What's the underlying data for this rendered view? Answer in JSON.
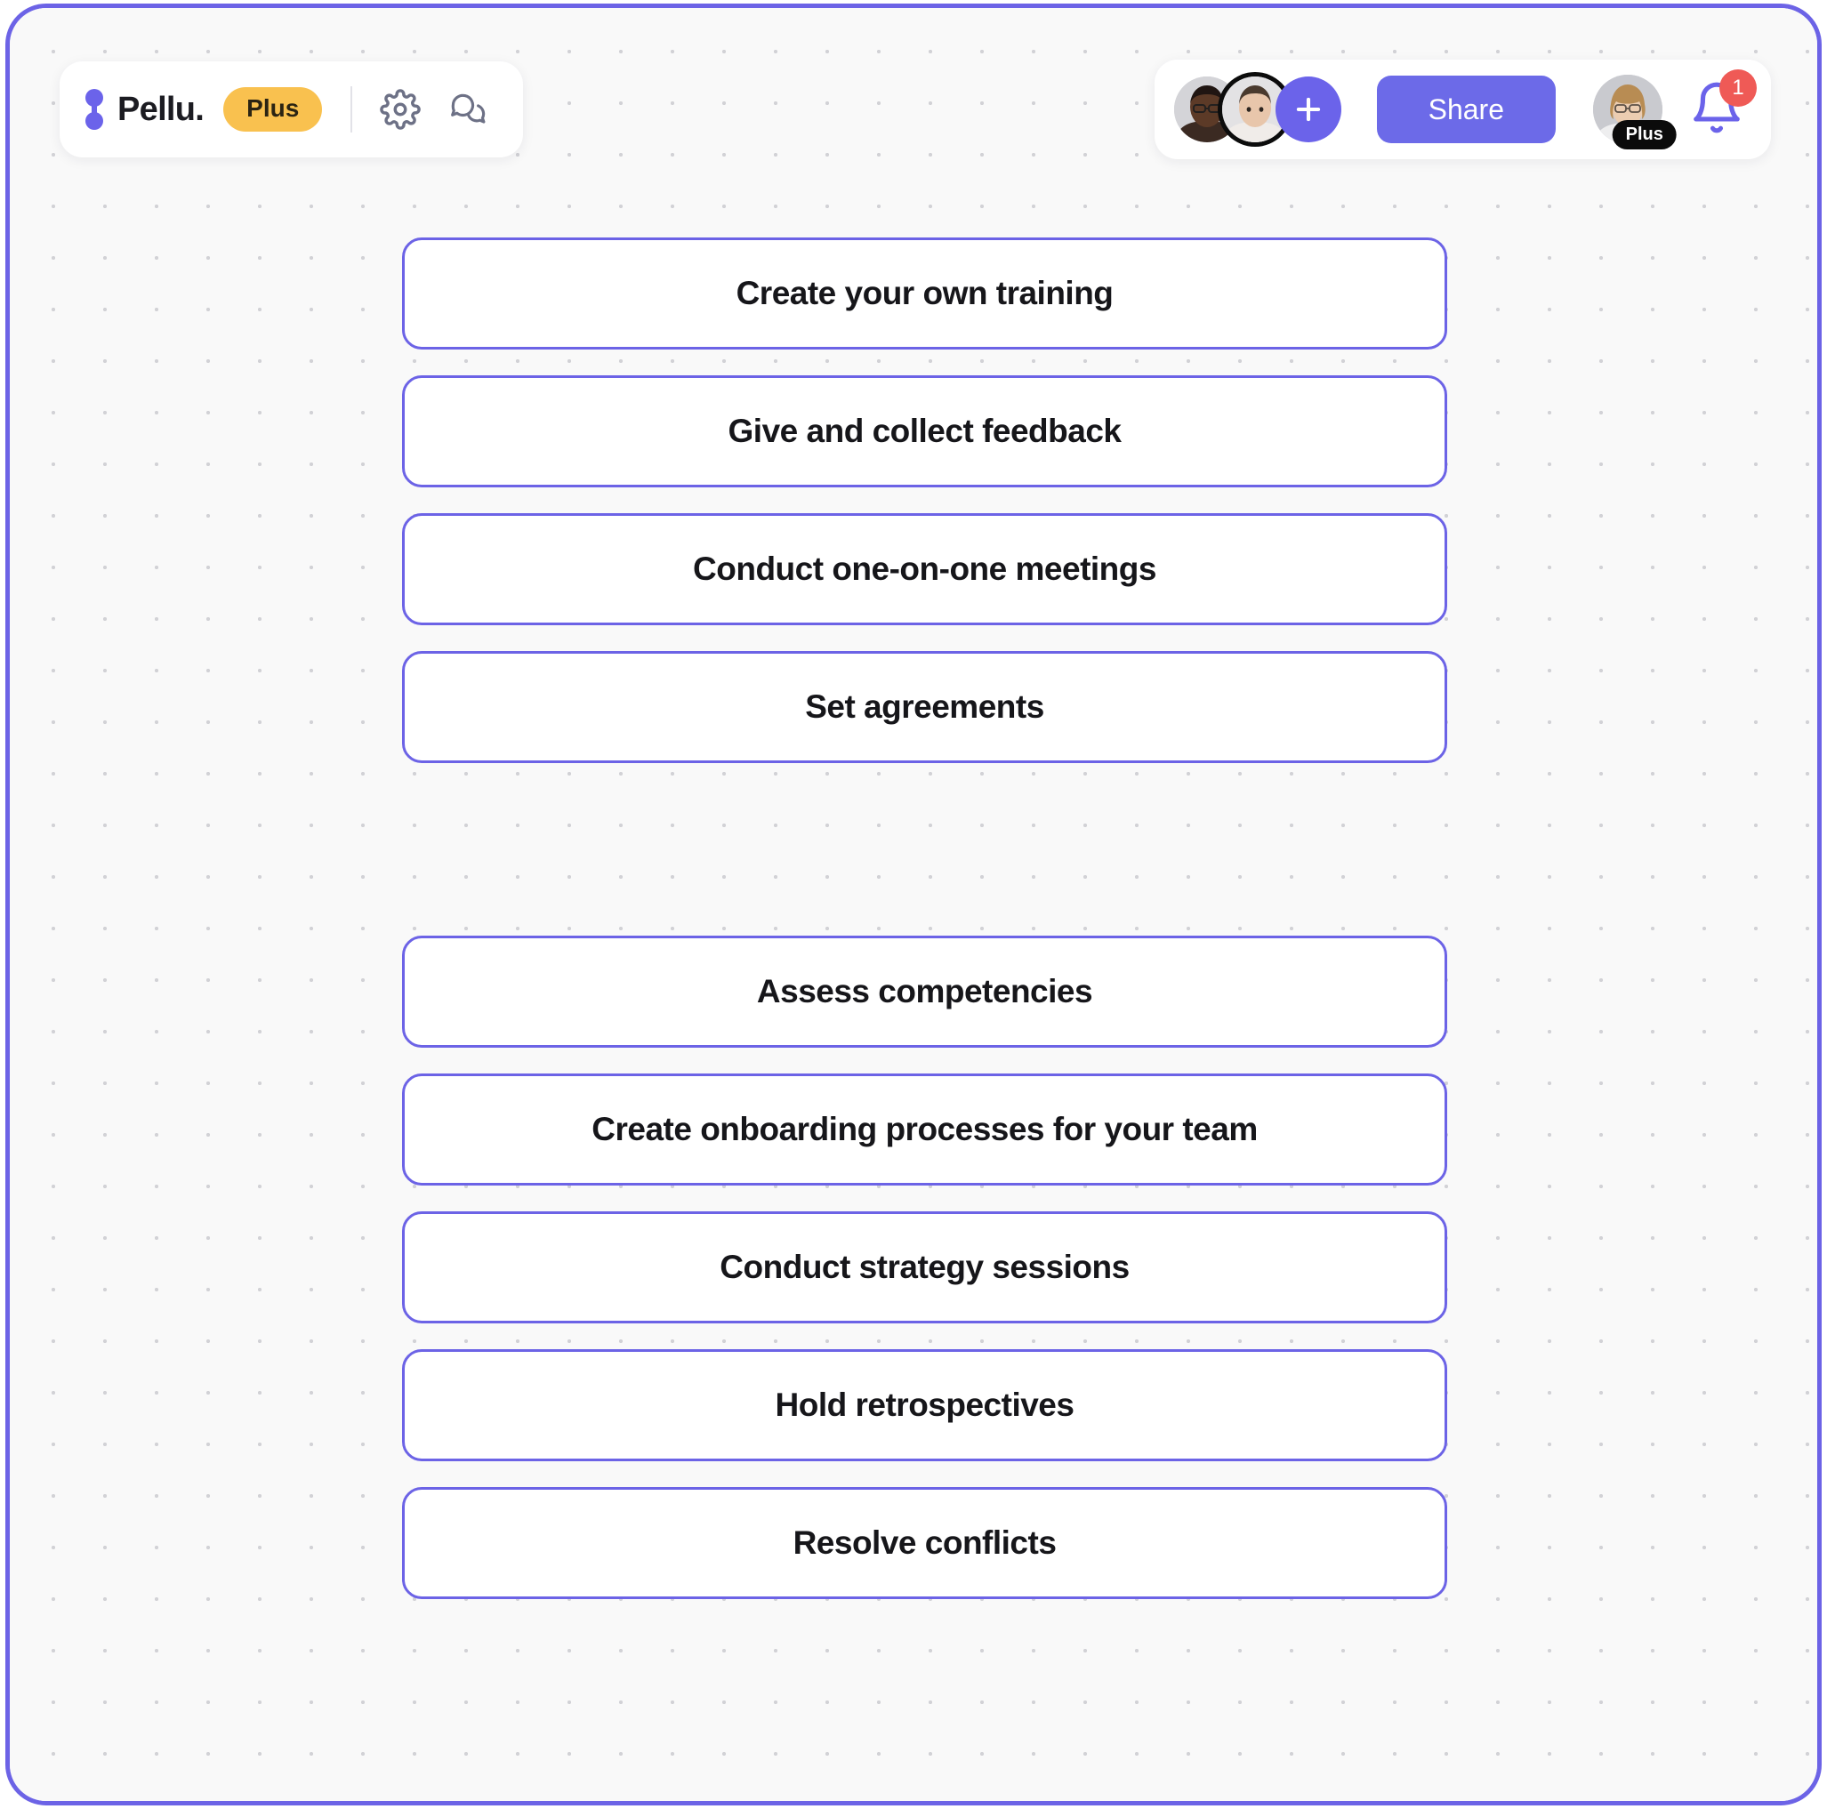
{
  "brand": {
    "name": "Pellu.",
    "logo_icon": "hourglass-logo-icon",
    "plan_badge": "Plus",
    "accent_purple": "#6c63e6",
    "badge_amber": "#f9c14f"
  },
  "toolbar_left": {
    "settings_icon": "gear-icon",
    "comments_icon": "chat-bubbles-icon"
  },
  "toolbar_right": {
    "collaborators": [
      {
        "name": "collaborator-1",
        "ring": false
      },
      {
        "name": "collaborator-2",
        "ring": true
      }
    ],
    "add_member_icon": "plus-icon",
    "share_label": "Share",
    "share_color": "#6c6ae8",
    "profile": {
      "name": "current-user",
      "plan_badge": "Plus"
    },
    "notifications": {
      "icon": "bell-icon",
      "count": "1",
      "badge_color": "#ef5a56"
    }
  },
  "board": {
    "groups": [
      {
        "id": "group-a",
        "cards": [
          {
            "label": "Create your own training"
          },
          {
            "label": "Give and collect feedback"
          },
          {
            "label": "Conduct one-on-one meetings"
          },
          {
            "label": "Set agreements"
          }
        ]
      },
      {
        "id": "group-b",
        "cards": [
          {
            "label": "Assess competencies"
          },
          {
            "label": "Create onboarding processes for your team"
          },
          {
            "label": "Conduct strategy sessions"
          },
          {
            "label": "Hold retrospectives"
          },
          {
            "label": "Resolve conflicts"
          }
        ]
      }
    ]
  }
}
